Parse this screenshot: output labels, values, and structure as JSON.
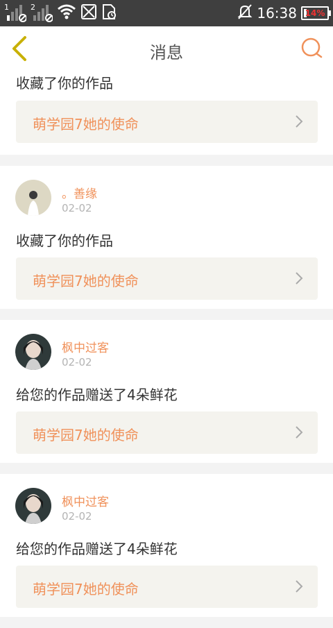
{
  "status_bar": {
    "sim1_label": "1",
    "sim2_label": "2",
    "time": "16:38",
    "battery_percent": "14%",
    "battery_level": 0.14,
    "icons": [
      "signal-icon",
      "signal-icon",
      "wifi-icon",
      "no-sim-icon",
      "sd-card-icon",
      "notifications-off-icon",
      "battery-icon"
    ]
  },
  "header": {
    "title": "消息",
    "back_icon": "chevron-left-icon",
    "search_icon": "search-icon"
  },
  "messages": [
    {
      "message": "收藏了你的作品",
      "work_title": "萌学园7她的使命"
    },
    {
      "username": "。善缘",
      "date": "02-02",
      "message": "收藏了你的作品",
      "work_title": "萌学园7她的使命"
    },
    {
      "username": "枫中过客",
      "date": "02-02",
      "message": "给您的作品赠送了4朵鲜花",
      "work_title": "萌学园7她的使命"
    },
    {
      "username": "枫中过客",
      "date": "02-02",
      "message": "给您的作品赠送了4朵鲜花",
      "work_title": "萌学园7她的使命"
    }
  ],
  "colors": {
    "accent": "#f0915a",
    "back_arrow": "#c8b000"
  }
}
